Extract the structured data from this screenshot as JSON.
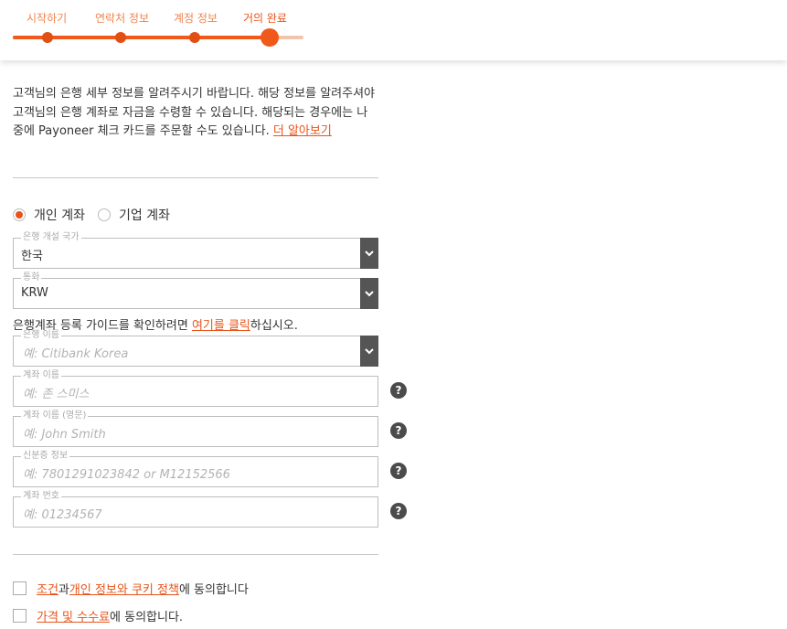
{
  "progress": {
    "steps": [
      "시작하기",
      "연락처 정보",
      "계정 정보",
      "거의 완료"
    ],
    "current_step": 4
  },
  "intro": {
    "text": "고객님의 은행 세부 정보를 알려주시기 바랍니다. 해당 정보를 알려주셔야 고객님의 은행 계좌로 자금을 수령할 수 있습니다. 해당되는 경우에는 나중에 Payoneer 체크 카드를 주문할 수도 있습니다. ",
    "learn_more": "더 알아보기"
  },
  "account_type": {
    "personal": "개인 계좌",
    "business": "기업 계좌",
    "selected": "personal"
  },
  "fields": {
    "bank_country": {
      "label": "은행 개설 국가",
      "value": "한국"
    },
    "currency": {
      "label": "통화",
      "value": "KRW"
    },
    "bank_name": {
      "label": "은행 이름",
      "placeholder": "예: Citibank Korea"
    },
    "account_name": {
      "label": "계좌 이름",
      "placeholder": "예: 존 스미스"
    },
    "account_name_en": {
      "label": "계좌 이름 (영문)",
      "placeholder": "예: John Smith"
    },
    "id_info": {
      "label": "신분증 정보",
      "placeholder": "예: 7801291023842 or M12152566"
    },
    "account_number": {
      "label": "계좌 번호",
      "placeholder": "예: 01234567"
    }
  },
  "guide": {
    "prefix": "은행계좌 등록 가이드를 확인하려면 ",
    "link": "여기를 클릭",
    "suffix": "하십시오."
  },
  "agreements": {
    "terms_link": "조건",
    "and": "과",
    "privacy_link": "개인 정보와 쿠키 정책",
    "terms_suffix": "에 동의합니다",
    "fees_link": "가격 및 수수료",
    "fees_suffix": "에 동의합니다."
  },
  "help_glyph": "?",
  "colors": {
    "accent": "#e8541a",
    "dark": "#4b4b4b"
  }
}
